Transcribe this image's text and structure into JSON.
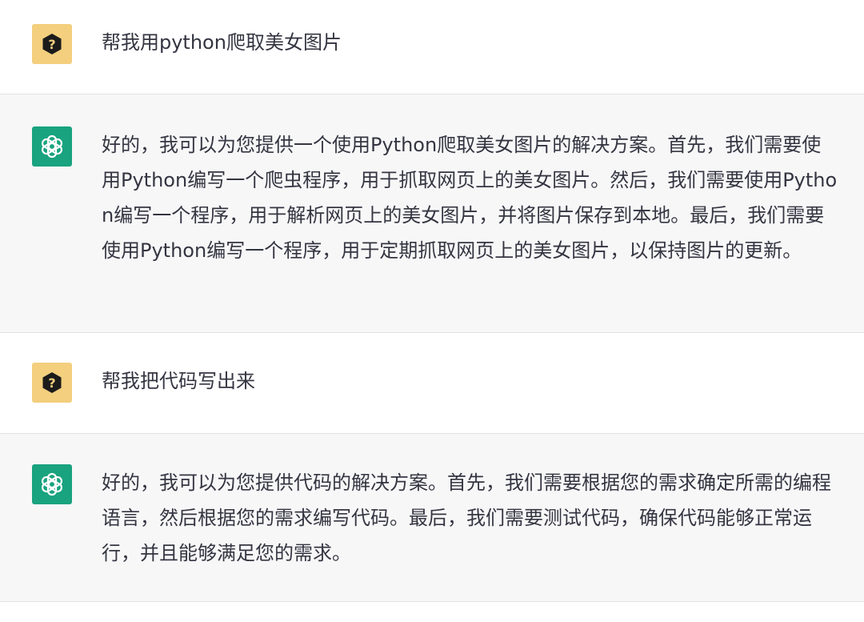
{
  "conversation": {
    "messages": [
      {
        "role": "user",
        "avatar_icon": "question-mark-hexagon-icon",
        "text": "帮我用python爬取美女图片"
      },
      {
        "role": "assistant",
        "avatar_icon": "openai-logo-icon",
        "text": "好的，我可以为您提供一个使用Python爬取美女图片的解决方案。首先，我们需要使用Python编写一个爬虫程序，用于抓取网页上的美女图片。然后，我们需要使用Python编写一个程序，用于解析网页上的美女图片，并将图片保存到本地。最后，我们需要使用Python编写一个程序，用于定期抓取网页上的美女图片，以保持图片的更新。"
      },
      {
        "role": "user",
        "avatar_icon": "question-mark-hexagon-icon",
        "text": "帮我把代码写出来"
      },
      {
        "role": "assistant",
        "avatar_icon": "openai-logo-icon",
        "text": "好的，我可以为您提供代码的解决方案。首先，我们需要根据您的需求确定所需的编程语言，然后根据您的需求编写代码。最后，我们需要测试代码，确保代码能够正常运行，并且能够满足您的需求。"
      }
    ]
  },
  "colors": {
    "user_bg": "#ffffff",
    "assistant_bg": "#f7f7f8",
    "user_avatar_bg": "#f3cf7e",
    "assistant_avatar_bg": "#19a37f",
    "text": "#343541"
  }
}
